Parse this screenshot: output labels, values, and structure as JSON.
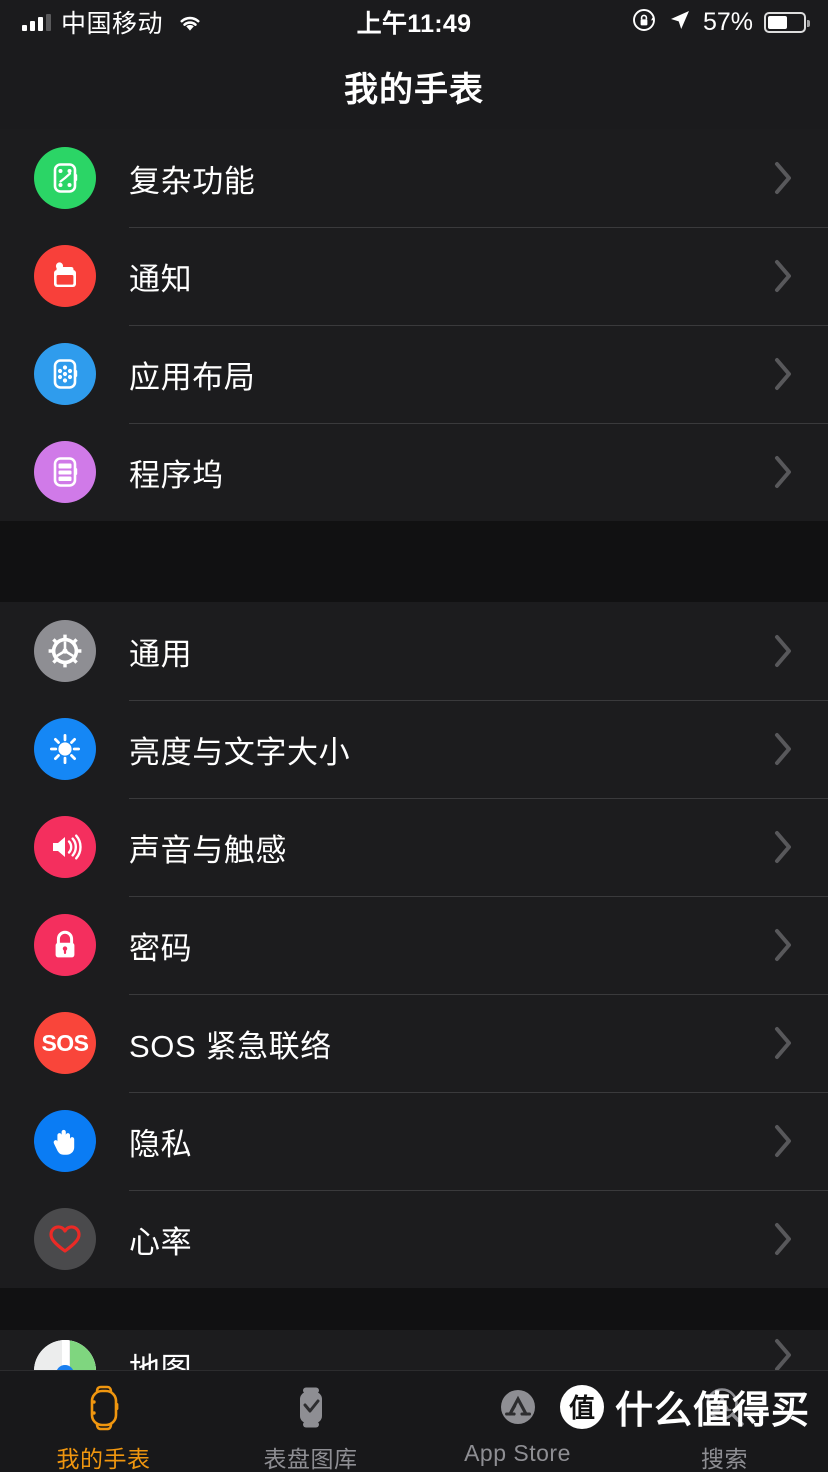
{
  "statusbar": {
    "carrier": "中国移动",
    "time": "上午11:49",
    "battery_percent": "57%",
    "signal_icon": "cellular-bars-icon",
    "wifi_icon": "wifi-icon",
    "rotation_lock_icon": "rotation-lock-icon",
    "location_icon": "location-arrow-icon",
    "battery_icon": "battery-icon",
    "battery_level": 57
  },
  "navbar": {
    "title": "我的手表"
  },
  "colors": {
    "accent": "#f0960f",
    "row_bg": "#1c1c1e",
    "page_bg": "#111112",
    "separator": "#3a3a3c",
    "label": "#ffffff",
    "inactive_tab": "#8e8e93",
    "complications": "#2bd566",
    "notifications": "#f8403a",
    "app_layout": "#2f9ced",
    "dock": "#d07ae8",
    "general": "#8e8e93",
    "brightness": "#1587f5",
    "sounds": "#f42f5e",
    "passcode": "#f42f5e",
    "sos": "#f9453a",
    "privacy": "#0a7cf4",
    "heart_rate": "#4a4a4c",
    "heart_rate_glyph": "#ea2a26"
  },
  "sections": [
    {
      "id": "watch-config",
      "rows": [
        {
          "label": "复杂功能",
          "icon": "watch-complications-icon"
        },
        {
          "label": "通知",
          "icon": "notifications-icon"
        },
        {
          "label": "应用布局",
          "icon": "app-layout-icon"
        },
        {
          "label": "程序坞",
          "icon": "dock-icon"
        }
      ]
    },
    {
      "id": "watch-settings",
      "rows": [
        {
          "label": "通用",
          "icon": "gear-icon"
        },
        {
          "label": "亮度与文字大小",
          "icon": "brightness-icon"
        },
        {
          "label": "声音与触感",
          "icon": "speaker-icon"
        },
        {
          "label": "密码",
          "icon": "lock-icon"
        },
        {
          "label": "SOS 紧急联络",
          "icon": "sos-icon"
        },
        {
          "label": "隐私",
          "icon": "hand-icon"
        },
        {
          "label": "心率",
          "icon": "heart-icon"
        }
      ]
    },
    {
      "id": "watch-apps",
      "rows": [
        {
          "label": "地图",
          "icon": "maps-icon"
        }
      ]
    }
  ],
  "tabbar": {
    "tabs": [
      {
        "label": "我的手表",
        "icon": "watch-outline-icon",
        "active": true
      },
      {
        "label": "表盘图库",
        "icon": "watch-face-gallery-icon",
        "active": false
      },
      {
        "label": "App Store",
        "icon": "app-store-icon",
        "active": false
      },
      {
        "label": "搜索",
        "icon": "app-store-search-icon",
        "active": false
      }
    ]
  },
  "watermark": {
    "badge": "值",
    "text": "什么值得买"
  }
}
